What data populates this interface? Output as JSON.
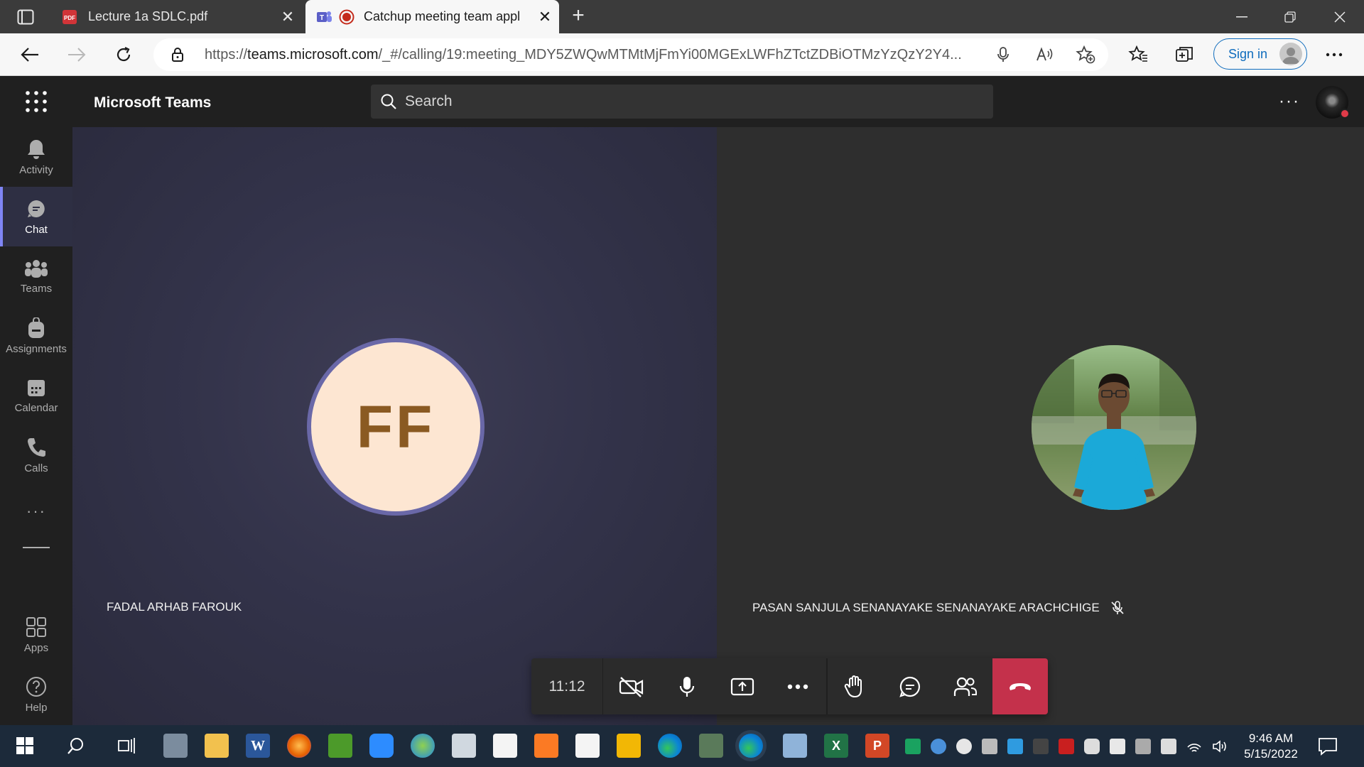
{
  "browser": {
    "tabs": [
      {
        "title": "Lecture 1a SDLC.pdf",
        "favicon": "pdf-icon",
        "active": false
      },
      {
        "title": "Catchup meeting team appl",
        "favicon": "teams-icon",
        "active": true
      }
    ],
    "address": {
      "url_prefix": "https://",
      "url_domain": "teams.microsoft.com",
      "url_path": "/_#/calling/19:meeting_MDY5ZWQwMTMtMjFmYi00MGExLWFhZTctZDBiOTMzYzQzY2Y4..."
    },
    "signin_label": "Sign in"
  },
  "teams": {
    "app_name": "Microsoft Teams",
    "search_placeholder": "Search",
    "rail": [
      {
        "label": "Activity",
        "icon": "bell-icon"
      },
      {
        "label": "Chat",
        "icon": "chat-icon",
        "active": true
      },
      {
        "label": "Teams",
        "icon": "people-icon"
      },
      {
        "label": "Assignments",
        "icon": "backpack-icon"
      },
      {
        "label": "Calendar",
        "icon": "calendar-icon"
      },
      {
        "label": "Calls",
        "icon": "phone-icon"
      },
      {
        "label": "Apps",
        "icon": "apps-icon"
      },
      {
        "label": "Help",
        "icon": "help-icon"
      }
    ],
    "more_dots": "···"
  },
  "meeting": {
    "participants": [
      {
        "name": "FADAL ARHAB FAROUK",
        "initials": "FF",
        "avatar_type": "initials"
      },
      {
        "name": "PASAN SANJULA SENANAYAKE SENANAYAKE ARACHCHIGE",
        "avatar_type": "photo",
        "muted": true
      }
    ],
    "timer": "11:12",
    "controls": [
      "camera-off",
      "microphone",
      "share-screen",
      "more-actions",
      "raise-hand",
      "chat",
      "participants",
      "leave"
    ]
  },
  "taskbar": {
    "time": "9:46 AM",
    "date": "5/15/2022"
  },
  "colors": {
    "accent": "#7f85f5",
    "hangup": "#c4314b",
    "link_blue": "#0f6cbd"
  }
}
